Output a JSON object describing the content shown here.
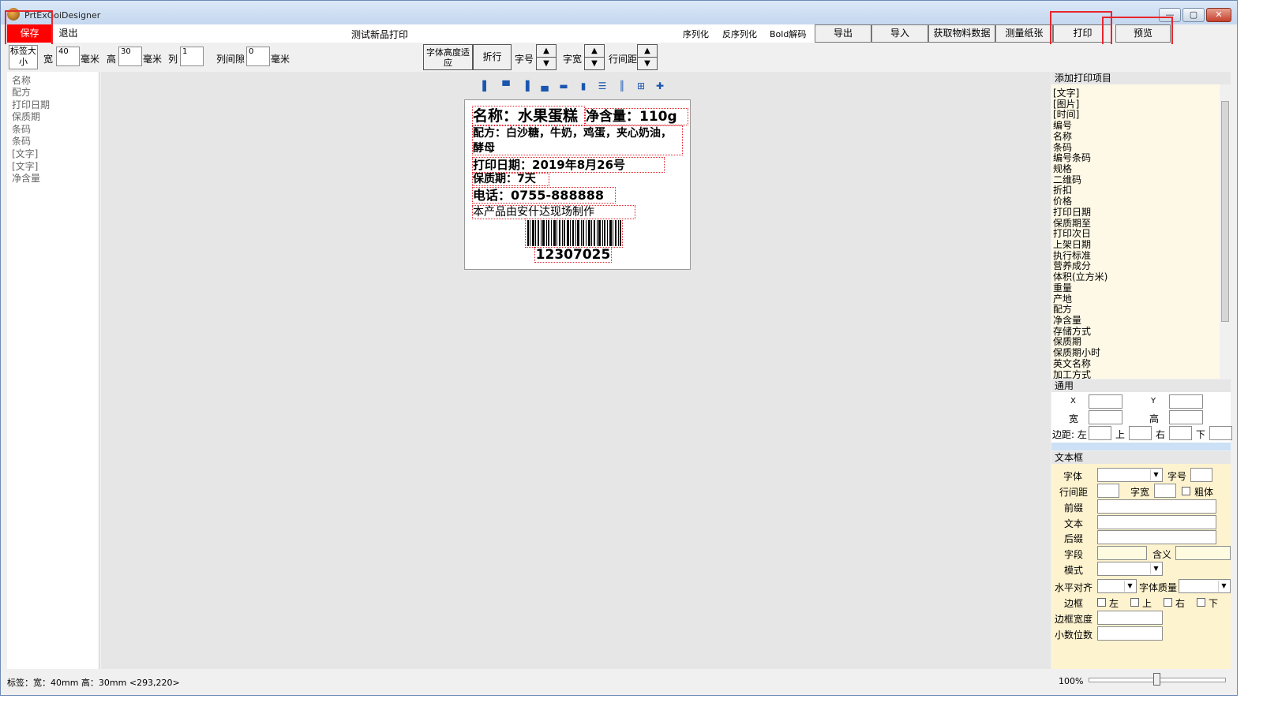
{
  "window": {
    "title": "PrtExGoiDesigner",
    "minimize": "—",
    "maximize": "▢",
    "close": "✕"
  },
  "toolbar": {
    "save": "保存",
    "exit": "退出",
    "title": "测试新品打印",
    "serialize": "序列化",
    "deserialize": "反序列化",
    "bold_decode": "Bold解码",
    "export": "导出",
    "import": "导入",
    "fetch_material": "获取物料数据",
    "measure_paper": "测量纸张",
    "print": "打印",
    "preview": "预览"
  },
  "sizebar": {
    "label_size": "标签大小",
    "width_label": "宽",
    "width": "40",
    "mm1": "毫米",
    "height_label": "高",
    "height": "30",
    "mm2": "毫米",
    "cols_label": "列",
    "cols": "1",
    "gap_label": "列间隙",
    "gap": "0",
    "mm3": "毫米",
    "font_fit": "字体高度适应",
    "wrap": "折行",
    "font_size": "字号",
    "font_width": "字宽",
    "line_spacing": "行间距"
  },
  "fields": [
    "名称",
    "配方",
    "打印日期",
    "保质期",
    "条码",
    "条码",
    "[文字]",
    "[文字]",
    "净含量"
  ],
  "label": {
    "name": "名称：水果蛋糕",
    "net": "净含量：110g",
    "recipe": "配方：白沙糖，牛奶，鸡蛋，夹心奶油，酵母",
    "date": "打印日期：2019年8月26号",
    "shelf": "保质期：7天",
    "phone": "电话：0755-888888",
    "made": "本产品由安什达现场制作",
    "barcode": "12307025"
  },
  "add_items": {
    "header": "添加打印项目",
    "items": [
      "[文字]",
      "[图片]",
      "[时间]",
      "编号",
      "名称",
      "条码",
      "编号条码",
      "规格",
      "二维码",
      "折扣",
      "价格",
      "打印日期",
      "保质期至",
      "打印次日",
      "上架日期",
      "执行标准",
      "营养成分",
      "体积(立方米)",
      "重量",
      "产地",
      "配方",
      "净含量",
      "存储方式",
      "保质期",
      "保质期小时",
      "英文名称",
      "加工方式"
    ]
  },
  "general": {
    "header": "通用",
    "x": "X",
    "y": "Y",
    "w": "宽",
    "h": "高",
    "margin": "边距: 左",
    "top": "上",
    "right": "右",
    "bottom": "下"
  },
  "textbox": {
    "header": "文本框",
    "font": "字体",
    "size": "字号",
    "line_spacing": "行间距",
    "char_width": "字宽",
    "bold": "粗体",
    "prefix": "前缀",
    "text": "文本",
    "suffix": "后缀",
    "field": "字段",
    "meaning": "含义",
    "mode": "模式",
    "h_align": "水平对齐",
    "font_quality": "字体质量",
    "border": "边框",
    "left": "左",
    "top": "上",
    "right": "右",
    "bottom": "下",
    "border_width": "边框宽度",
    "decimals": "小数位数"
  },
  "status": {
    "text": "标签：宽：40mm 高：30mm  <293,220>",
    "zoom": "100%"
  }
}
